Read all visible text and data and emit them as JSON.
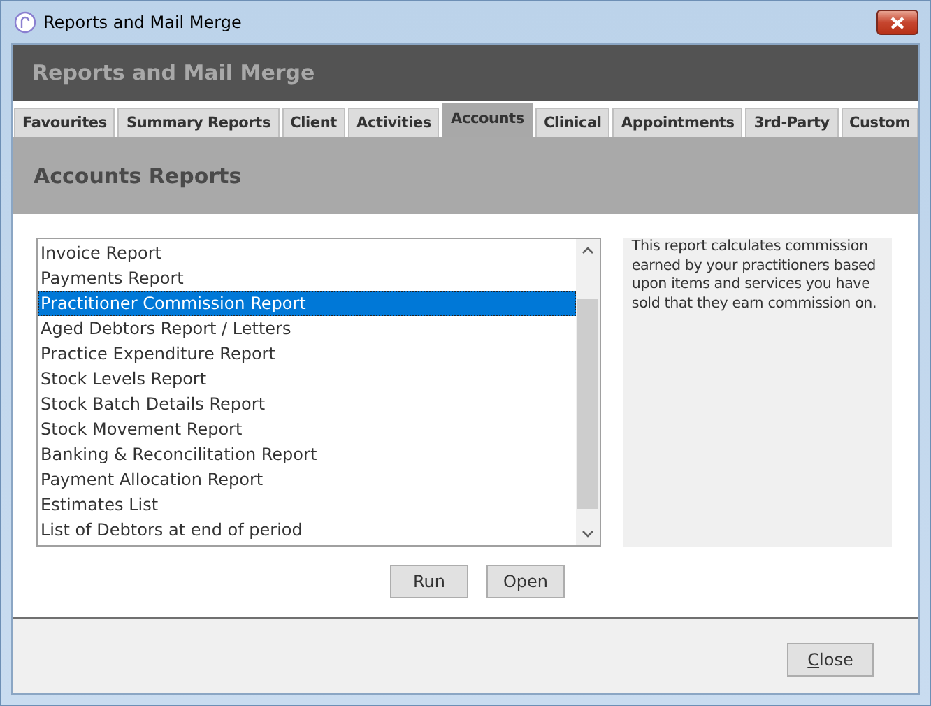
{
  "window": {
    "title": "Reports and Mail Merge"
  },
  "header": {
    "title": "Reports and Mail Merge"
  },
  "tabs": [
    {
      "label": "Favourites",
      "selected": false
    },
    {
      "label": "Summary Reports",
      "selected": false
    },
    {
      "label": "Client",
      "selected": false
    },
    {
      "label": "Activities",
      "selected": false
    },
    {
      "label": "Accounts",
      "selected": true
    },
    {
      "label": "Clinical",
      "selected": false
    },
    {
      "label": "Appointments",
      "selected": false
    },
    {
      "label": "3rd-Party",
      "selected": false
    },
    {
      "label": "Custom",
      "selected": false
    }
  ],
  "section": {
    "title": "Accounts Reports"
  },
  "reports": [
    {
      "label": "Invoice Report",
      "selected": false
    },
    {
      "label": "Payments Report",
      "selected": false
    },
    {
      "label": "Practitioner Commission Report",
      "selected": true
    },
    {
      "label": "Aged Debtors Report / Letters",
      "selected": false
    },
    {
      "label": "Practice Expenditure Report",
      "selected": false
    },
    {
      "label": "Stock Levels Report",
      "selected": false
    },
    {
      "label": "Stock Batch Details Report",
      "selected": false
    },
    {
      "label": "Stock Movement Report",
      "selected": false
    },
    {
      "label": "Banking & Reconcilitation Report",
      "selected": false
    },
    {
      "label": "Payment Allocation Report",
      "selected": false
    },
    {
      "label": "Estimates List",
      "selected": false
    },
    {
      "label": "List of Debtors at end of period",
      "selected": false
    }
  ],
  "description": "This report calculates commission earned by your practitioners based upon items and services you have sold that they earn commission on.",
  "buttons": [
    "Run",
    "Open"
  ],
  "footer_buttons": [
    "Close"
  ]
}
